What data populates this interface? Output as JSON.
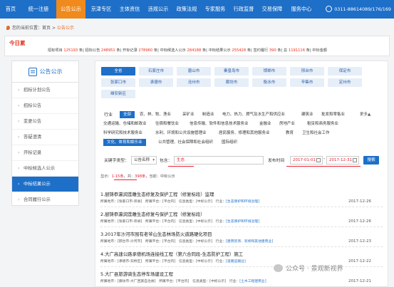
{
  "topnav": {
    "items": [
      "首页",
      "统一注册",
      "公告公示",
      "京津专区",
      "主体资信",
      "违规公示",
      "政策法规",
      "专家服务",
      "行政监督",
      "交易保障",
      "服务中心"
    ],
    "active_index": 2,
    "phone": "0311-88614089/176/169"
  },
  "breadcrumb": {
    "prefix": "您的当前位置：",
    "home": "首页",
    "sep": ">",
    "current": "公告公示"
  },
  "today": {
    "label": "今日累",
    "stats": [
      {
        "label": "招标项目",
        "value": "125193"
      },
      {
        "label": "招标公告",
        "value": "248951"
      },
      {
        "label": "开标记录",
        "value": "278960"
      },
      {
        "label": "中标候选人公示",
        "value": "284188"
      },
      {
        "label": "中标结果公示",
        "value": "255428"
      },
      {
        "label": "签约履行",
        "value": "390"
      },
      {
        "label": "总",
        "value": "1191116"
      }
    ],
    "unit": "条",
    "tail": "中标金额"
  },
  "sidebar": {
    "title": "公告公示",
    "items": [
      "招标计划公告",
      "招标公告",
      "变更公告",
      "答疑澄清",
      "开标记录",
      "中标候选人公示",
      "中标结果公示",
      "合同履行公示"
    ],
    "active_index": 6
  },
  "regions": [
    "全省",
    "石家庄市",
    "唐山市",
    "秦皇岛市",
    "邯郸市",
    "邢台市",
    "保定市",
    "张家口市",
    "承德市",
    "沧州市",
    "廊坊市",
    "衡水市",
    "辛集市",
    "定州市",
    "雄安新区"
  ],
  "industry": {
    "label": "行业",
    "more": "更多▲",
    "items": [
      "全部",
      "农、林、牧、渔业",
      "采矿业",
      "制造业",
      "电力、热力、燃气及水生产和供应业",
      "建筑业",
      "批发和零售业",
      "交通运输、仓储和邮政业",
      "住宿和餐饮业",
      "信息传输、软件和信息技术服务业",
      "金融业",
      "房地产业",
      "租赁和商务服务业",
      "科学研究和技术服务业",
      "水利、环境和公共设施管理业",
      "居民服务、修理和其他服务业",
      "教育",
      "卫生和社会工作",
      "文化、体育和娱乐业",
      "公共管理、社会保障和社会组织",
      "国际组织"
    ],
    "active": [
      "全部",
      "文化、体育和娱乐业"
    ]
  },
  "search": {
    "type_label": "关键字类型：",
    "type_value": "公告名称",
    "contains_label": "包含：",
    "keyword": "生态",
    "date_label": "发布时间",
    "date_from": "2017-01-01",
    "date_to": "2017-12-31",
    "button": "搜索"
  },
  "results_info": {
    "prefix": "显示：",
    "range": "1-15条",
    "mid": "，共：",
    "total": "398条",
    "suffix": "，当前：中标公示"
  },
  "results": [
    {
      "title": "1.厨铸忝瀛润莲雕生态修复及保护工程（修复标段）监理",
      "meta": "所属地市：[张家口市-崇县]　所属平台：[平台内]　信息类型：[中标公示]　行业：",
      "tag": "[生态保护和环境治理]",
      "date": "2017-12-26"
    },
    {
      "title": "2.厨铸忝瀛润莲雕生态修复与保护工程（修复标段）",
      "meta": "所属地市：[张家口市-崇县]　所属平台：[平台内]　信息类型：[中标公示]　行业：",
      "tag": "[生态保护和环境治理]",
      "date": "2017-12-26"
    },
    {
      "title": "3.2017年沙河市围有老爷山生态林场防火道路硬化项目",
      "meta": "所属地市：[邢台市-沙河市]　所属平台：[平台内]　信息类型：[中标公示]　行业：",
      "tag": "[建筑装饰、装修和其他建筑业]",
      "date": "2017-12-23"
    },
    {
      "title": "4.大广高速公路承德机场连接线工程（第六合同段-生态防护工程）施工",
      "meta": "所属地市：[承德市-双桥区]　所属平台：[平台内]　信息类型：[中标公示]　行业：",
      "tag": "[道路运输业]",
      "date": "2017-12-22"
    },
    {
      "title": "5.大厂县旅游骑生态停车场建设工程",
      "meta": "所属地市：[廊坊市-大厂回族自治县]　所属平台：[平台内]　信息类型：[中标公示]　行业：",
      "tag": "[土木工程建筑业]",
      "date": "2017-12-21"
    }
  ],
  "watermark": "公众号 · 景观新视界",
  "colors": {
    "nav_blue": "#1e6fc8",
    "nav_active": "#f08a1c",
    "highlight_red": "#e8321a"
  }
}
